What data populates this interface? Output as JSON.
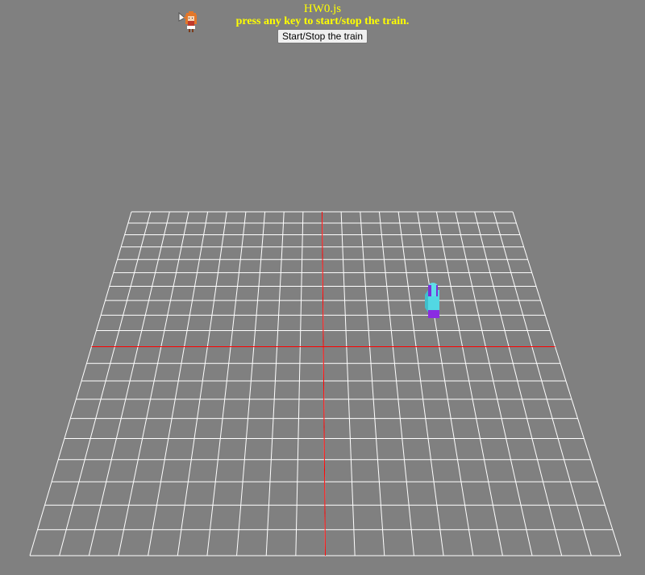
{
  "header": {
    "title": "HW0.js",
    "instruction": "press any key to start/stop the train."
  },
  "controls": {
    "toggle_button_label": "Start/Stop the train"
  },
  "icons": {
    "mascot": "pixel-character-icon"
  },
  "colors": {
    "background": "#808080",
    "header_text": "#ffff00",
    "grid_lines": "#ffffff",
    "axis_lines": "#ff0000",
    "train_body": "#4fd6e0",
    "train_accent": "#8a2be2"
  }
}
